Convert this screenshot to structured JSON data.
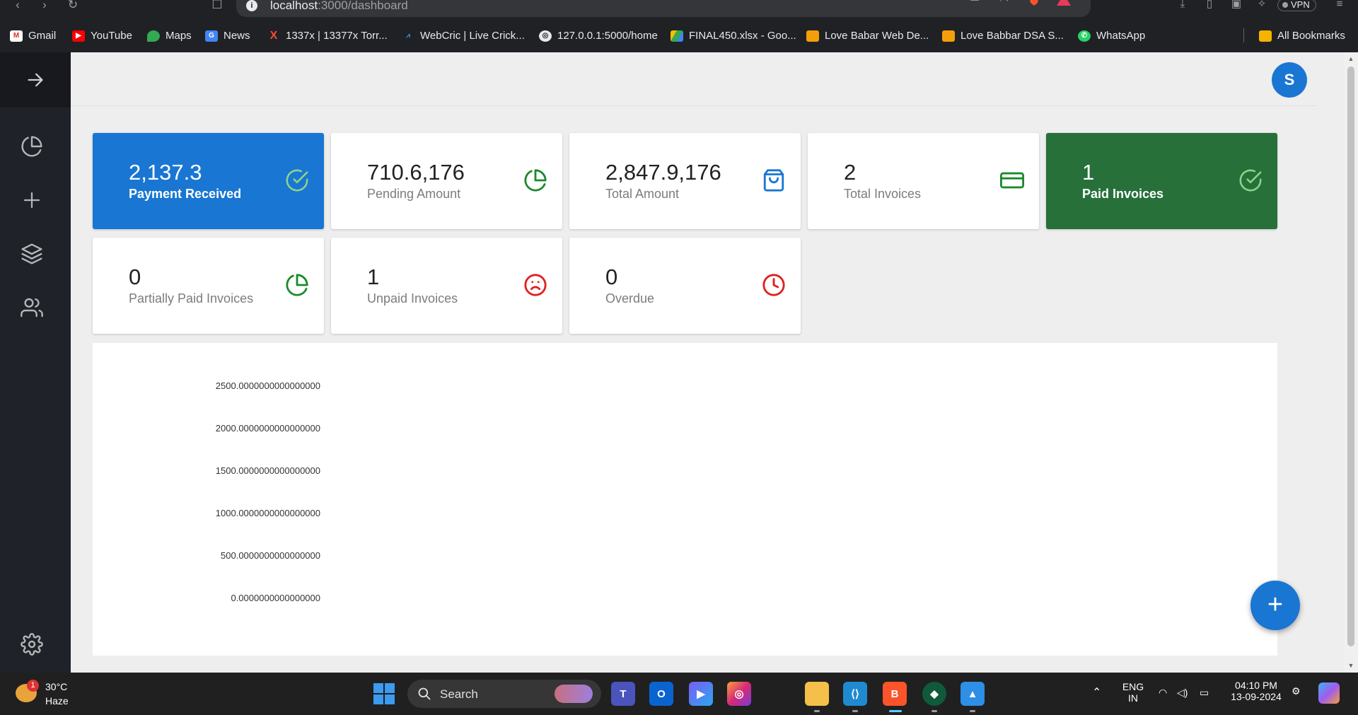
{
  "browser": {
    "url_host": "localhost",
    "url_path": ":3000/dashboard",
    "vpn_label": "VPN",
    "bookmarks": [
      {
        "label": "Gmail",
        "icon": "gmail-icon"
      },
      {
        "label": "YouTube",
        "icon": "youtube-icon"
      },
      {
        "label": "Maps",
        "icon": "maps-icon"
      },
      {
        "label": "News",
        "icon": "news-icon"
      },
      {
        "label": "1337x | 13377x Torr...",
        "icon": "1337x-icon"
      },
      {
        "label": "WebCric | Live Crick...",
        "icon": "webcric-icon"
      },
      {
        "label": "127.0.0.1:5000/home",
        "icon": "globe-icon"
      },
      {
        "label": "FINAL450.xlsx - Goo...",
        "icon": "drive-icon"
      },
      {
        "label": "Love Babar Web De...",
        "icon": "bookmark-icon"
      },
      {
        "label": "Love Babbar DSA S...",
        "icon": "bookmark-icon"
      },
      {
        "label": "WhatsApp",
        "icon": "whatsapp-icon"
      }
    ],
    "all_bookmarks": "All Bookmarks"
  },
  "header": {
    "avatar_letter": "S"
  },
  "cards": [
    {
      "value": "2,137.3",
      "label": "Payment Received",
      "icon": "check-circle-icon"
    },
    {
      "value": "710.6,176",
      "label": "Pending Amount",
      "icon": "pie-chart-icon"
    },
    {
      "value": "2,847.9,176",
      "label": "Total Amount",
      "icon": "shopping-bag-icon"
    },
    {
      "value": "2",
      "label": "Total Invoices",
      "icon": "credit-card-icon"
    },
    {
      "value": "1",
      "label": "Paid Invoices",
      "icon": "check-circle-icon"
    },
    {
      "value": "0",
      "label": "Partially Paid Invoices",
      "icon": "pie-chart-icon"
    },
    {
      "value": "1",
      "label": "Unpaid Invoices",
      "icon": "frown-icon"
    },
    {
      "value": "0",
      "label": "Overdue",
      "icon": "clock-icon"
    }
  ],
  "colors": {
    "primary": "#1976d2",
    "success": "#27703a",
    "icon_green": "#1a8a2a",
    "icon_blue": "#1976d2",
    "icon_red": "#e02020",
    "sidebar": "#1f2229"
  },
  "chart_data": {
    "type": "line",
    "yticks": [
      "2500.0000000000000000",
      "2000.0000000000000000",
      "1500.0000000000000000",
      "1000.0000000000000000",
      "500.0000000000000000",
      "0.0000000000000000"
    ],
    "ylim": [
      0,
      2500
    ],
    "series": []
  },
  "fab": {
    "label": "+"
  },
  "taskbar": {
    "weather_badge": "1",
    "temperature": "30°C",
    "condition": "Haze",
    "search_label": "Search",
    "lang_top": "ENG",
    "lang_bottom": "IN",
    "time": "04:10 PM",
    "date": "13-09-2024"
  }
}
